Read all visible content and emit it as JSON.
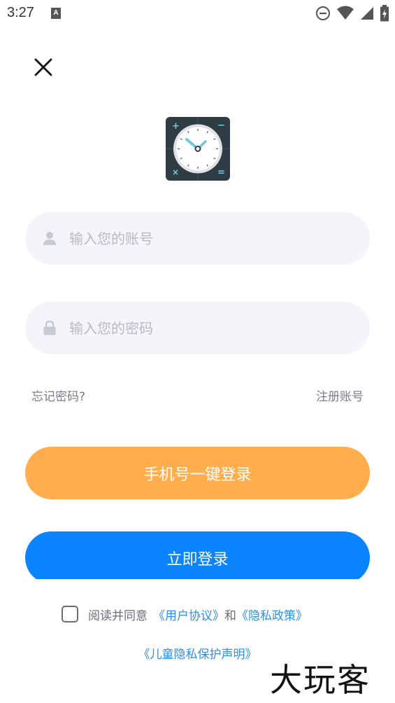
{
  "status_bar": {
    "time": "3:27",
    "notification_icon": "A",
    "icons": [
      "do-not-disturb-icon",
      "wifi-icon",
      "signal-icon",
      "battery-charging-icon"
    ]
  },
  "close_icon": "close-icon",
  "app_logo": "clock-calculator-logo",
  "form": {
    "account_placeholder": "输入您的账号",
    "account_value": "",
    "password_placeholder": "输入您的密码",
    "password_value": ""
  },
  "links": {
    "forgot": "忘记密码?",
    "register": "注册账号"
  },
  "buttons": {
    "phone_login": "手机号一键登录",
    "login": "立即登录"
  },
  "agreement": {
    "prefix": "阅读并同意",
    "user_agreement": "《用户协议》",
    "and": "和",
    "privacy_policy": "《隐私政策》",
    "children_privacy": "《儿童隐私保护声明》",
    "checked": false
  },
  "watermark": "大玩客",
  "colors": {
    "phone_button": "#ffad4d",
    "login_button": "#0a85ff",
    "link_blue": "#2d8ee8",
    "field_bg": "#f4f5fa"
  }
}
